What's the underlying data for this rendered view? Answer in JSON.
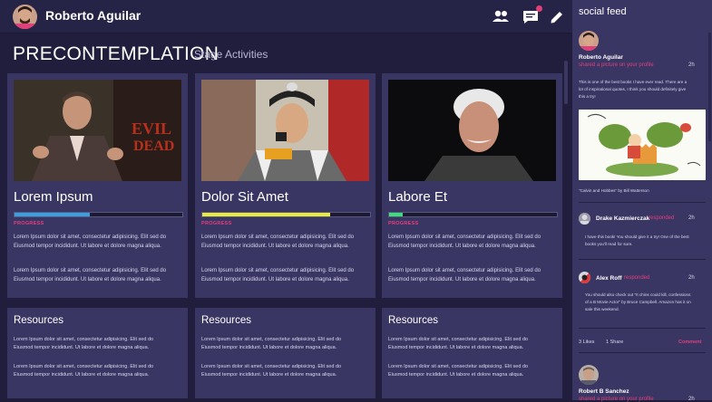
{
  "header": {
    "user_name": "Roberto Aguilar",
    "icons": [
      "people-icon",
      "chat-icon",
      "pencil-icon"
    ]
  },
  "page": {
    "title": "PRECONTEMPLATION",
    "subtitle": "Stage Activities"
  },
  "cards": [
    {
      "title": "Lorem Ipsum",
      "progress_label": "PROGRESS",
      "progress": 0.45,
      "bar_color": "#3aa0e0",
      "para1": "Lorem Ipsum dolor sit amet, consectetur adipisicing. Elit sed do Eiusmod tempor incididunt. Ut labore et dolore magna aliqua.",
      "para2": "Lorem Ipsum dolor sit amet, consectetur adipisicing. Elit sed do Eiusmod tempor incididunt. Ut labore et dolore magna aliqua."
    },
    {
      "title": "Dolor Sit Amet",
      "progress_label": "PROGRESS",
      "progress": 0.76,
      "bar_color": "#e8ec3a",
      "para1": "Lorem Ipsum dolor sit amet, consectetur adipisicing. Elit sed do Eiusmod tempor incididunt. Ut labore et dolore magna aliqua.",
      "para2": "Lorem Ipsum dolor sit amet, consectetur adipisicing. Elit sed do Eiusmod tempor incididunt. Ut labore et dolore magna aliqua."
    },
    {
      "title": "Labore Et",
      "progress_label": "PROGRESS",
      "progress": 0.08,
      "bar_color": "#3ae07a",
      "para1": "Lorem Ipsum dolor sit amet, consectetur adipisicing. Elit sed do Eiusmod tempor incididunt. Ut labore et dolore magna aliqua.",
      "para2": "Lorem Ipsum dolor sit amet, consectetur adipisicing. Elit sed do Eiusmod tempor incididunt. Ut labore et dolore magna aliqua."
    }
  ],
  "resources": [
    {
      "title": "Resources",
      "para1": "Lorem Ipsum dolor sit amet, consectetur adipisicing. Elit sed do Eiusmod tempor incididunt. Ut labore et dolore magna aliqua.",
      "para2": "Lorem Ipsum dolor sit amet, consectetur adipisicing. Elit sed do Eiusmod tempor incididunt. Ut labore et dolore magna aliqua."
    },
    {
      "title": "Resources",
      "para1": "Lorem Ipsum dolor sit amet, consectetur adipisicing. Elit sed do Eiusmod tempor incididunt. Ut labore et dolore magna aliqua.",
      "para2": "Lorem Ipsum dolor sit amet, consectetur adipisicing. Elit sed do Eiusmod tempor incididunt. Ut labore et dolore magna aliqua."
    },
    {
      "title": "Resources",
      "para1": "Lorem Ipsum dolor sit amet, consectetur adipisicing. Elit sed do Eiusmod tempor incididunt. Ut labore et dolore magna aliqua.",
      "para2": "Lorem Ipsum dolor sit amet, consectetur adipisicing. Elit sed do Eiusmod tempor incididunt. Ut labore et dolore magna aliqua."
    }
  ],
  "feed": {
    "title": "social feed",
    "post": {
      "name": "Roberto Aguilar",
      "action": "shared a picture on your profile",
      "time": "2h",
      "text": "This is one of the best books I have ever read. There are a lot of inspirational quotes, I think you should definitely give this a try!",
      "caption": "\"Calvin and Hobbes\" by Bill Watterson"
    },
    "comments": [
      {
        "name": "Drake Kazmierczak",
        "action": "responded",
        "time": "2h",
        "text": "I have this book! You should give it a try! One of the best books you'll read for sure."
      },
      {
        "name": "Alex Roff",
        "action": "responded",
        "time": "2h",
        "text": "You should also check out \"It chins could kill, confessions of a B Movie Actor\" by Bruce Campbell. Amazon has it on sale this weekend."
      }
    ],
    "likes": "3 Likes",
    "shares": "1 Share",
    "comment_label": "Comment",
    "next_post": {
      "name": "Robert B Sanchez",
      "action": "shared a picture on your profile",
      "time": "2h"
    }
  },
  "colors": {
    "accent": "#e0407a",
    "panel": "#3a3664",
    "background": "#201e3c"
  }
}
